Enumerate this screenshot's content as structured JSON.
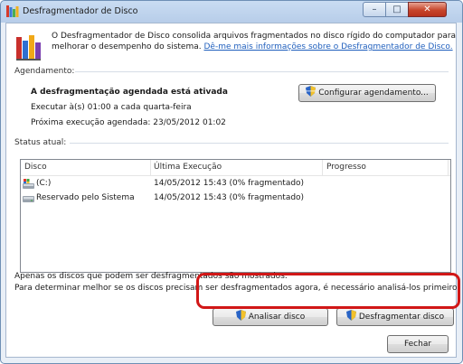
{
  "window": {
    "title": "Desfragmentador de Disco",
    "controls": {
      "minimize": "–",
      "maximize": "□",
      "close": "✕"
    }
  },
  "intro": {
    "line1": "O Desfragmentador de Disco consolida arquivos fragmentados no disco rígido do computador para",
    "line2_text": "melhorar o desempenho do sistema.",
    "link": "Dê-me mais informações sobre o Desfragmentador de Disco."
  },
  "schedule": {
    "heading": "Agendamento:",
    "status": "A desfragmentação agendada está ativada",
    "run": "Executar à(s) 01:00 a cada quarta-feira",
    "next": "Próxima execução agendada: 23/05/2012 01:02",
    "configure_button": "Configurar agendamento..."
  },
  "status": {
    "heading": "Status atual:",
    "columns": [
      "Disco",
      "Última Execução",
      "Progresso"
    ],
    "rows": [
      {
        "disk": "(C:)",
        "last_run": "14/05/2012 15:43 (0% fragmentado)",
        "progress": ""
      },
      {
        "disk": "Reservado pelo Sistema",
        "last_run": "14/05/2012 15:43 (0% fragmentado)",
        "progress": ""
      }
    ]
  },
  "notes": {
    "line1": "Apenas os discos que podem ser desfragmentados são mostrados.",
    "line2": "Para determinar melhor se os discos precisam ser desfragmentados agora, é necessário analisá-los primeiro."
  },
  "actions": {
    "analyze": "Analisar disco",
    "defragment": "Desfragmentar disco",
    "close": "Fechar"
  },
  "colors": {
    "link": "#1f5fbd",
    "highlight": "#d11717",
    "titlebar": "#c9dcf2"
  },
  "icons": [
    "defrag-app-icon",
    "shield-icon",
    "drive-c-icon",
    "drive-reserved-icon"
  ]
}
